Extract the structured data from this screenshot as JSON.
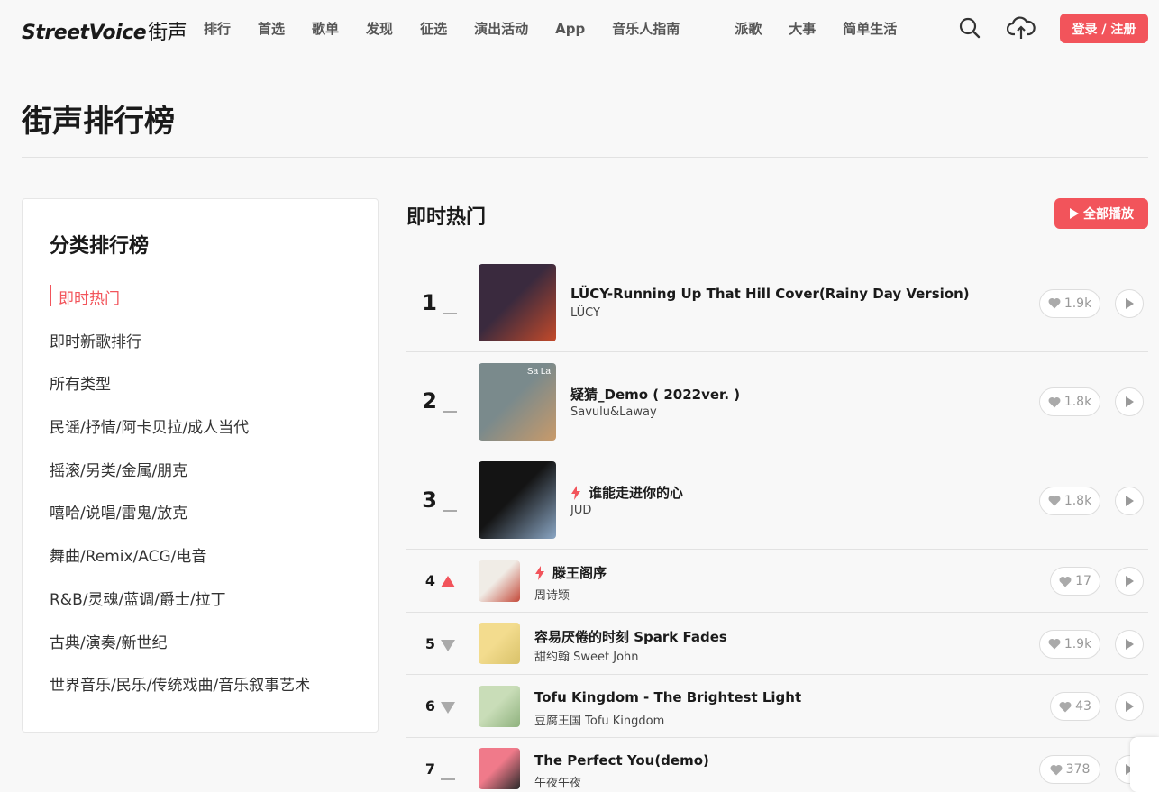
{
  "header": {
    "logo_text": "StreetVoice",
    "logo_cn": "街声",
    "nav": [
      "排行",
      "首选",
      "歌单",
      "发现",
      "征选",
      "演出活动",
      "App",
      "音乐人指南"
    ],
    "nav2": [
      "派歌",
      "大事",
      "简单生活"
    ],
    "login_label": "登录 / 注册",
    "search_icon": "search-icon",
    "upload_icon": "upload-cloud-icon"
  },
  "page_title": "街声排行榜",
  "sidebar": {
    "title": "分类排行榜",
    "items": [
      "即时热门",
      "即时新歌排行",
      "所有类型",
      "民谣/抒情/阿卡贝拉/成人当代",
      "摇滚/另类/金属/朋克",
      "嘻哈/说唱/雷鬼/放克",
      "舞曲/Remix/ACG/电音",
      "R&B/灵魂/蓝调/爵士/拉丁",
      "古典/演奏/新世纪",
      "世界音乐/民乐/传统戏曲/音乐叙事艺术"
    ],
    "active_index": 0
  },
  "main": {
    "title": "即时热门",
    "play_all_label": "全部播放"
  },
  "tracks": [
    {
      "rank": "1",
      "trend": "same",
      "title": "LÜCY-Running Up That Hill Cover(Rainy Day Version)",
      "artist": "LÜCY",
      "likes": "1.9k",
      "hot": false,
      "cover_colors": [
        "#3a2a3e",
        "#c44a2a"
      ]
    },
    {
      "rank": "2",
      "trend": "same",
      "title": "疑猜_Demo ( 2022ver. )",
      "artist": "Savulu&Laway",
      "likes": "1.8k",
      "hot": false,
      "cover_colors": [
        "#7a8a8c",
        "#c89a6a"
      ],
      "cover_text": "Sa La"
    },
    {
      "rank": "3",
      "trend": "same",
      "title": "谁能走进你的心",
      "artist": "JUD",
      "likes": "1.8k",
      "hot": true,
      "cover_colors": [
        "#141414",
        "#8aa6c4"
      ]
    },
    {
      "rank": "4",
      "trend": "up",
      "title": "滕王阁序",
      "artist": "周诗颖",
      "likes": "17",
      "hot": true,
      "cover_colors": [
        "#f0ece6",
        "#c44a3a"
      ]
    },
    {
      "rank": "5",
      "trend": "down",
      "title": "容易厌倦的时刻 Spark Fades",
      "artist": "甜约翰 Sweet John",
      "likes": "1.9k",
      "hot": false,
      "cover_colors": [
        "#f3dc8e",
        "#d9c26a"
      ]
    },
    {
      "rank": "6",
      "trend": "down",
      "title": "Tofu Kingdom - The Brightest Light",
      "artist": "豆腐王国 Tofu Kingdom",
      "likes": "43",
      "hot": false,
      "cover_colors": [
        "#c9ddb8",
        "#8fb27e"
      ]
    },
    {
      "rank": "7",
      "trend": "same",
      "title": "The Perfect You(demo)",
      "artist": "午夜午夜",
      "likes": "378",
      "hot": false,
      "cover_colors": [
        "#f07a8a",
        "#2a2a2a"
      ]
    }
  ],
  "colors": {
    "accent": "#f2545b",
    "text": "#1a1a1a",
    "muted": "#999999"
  }
}
